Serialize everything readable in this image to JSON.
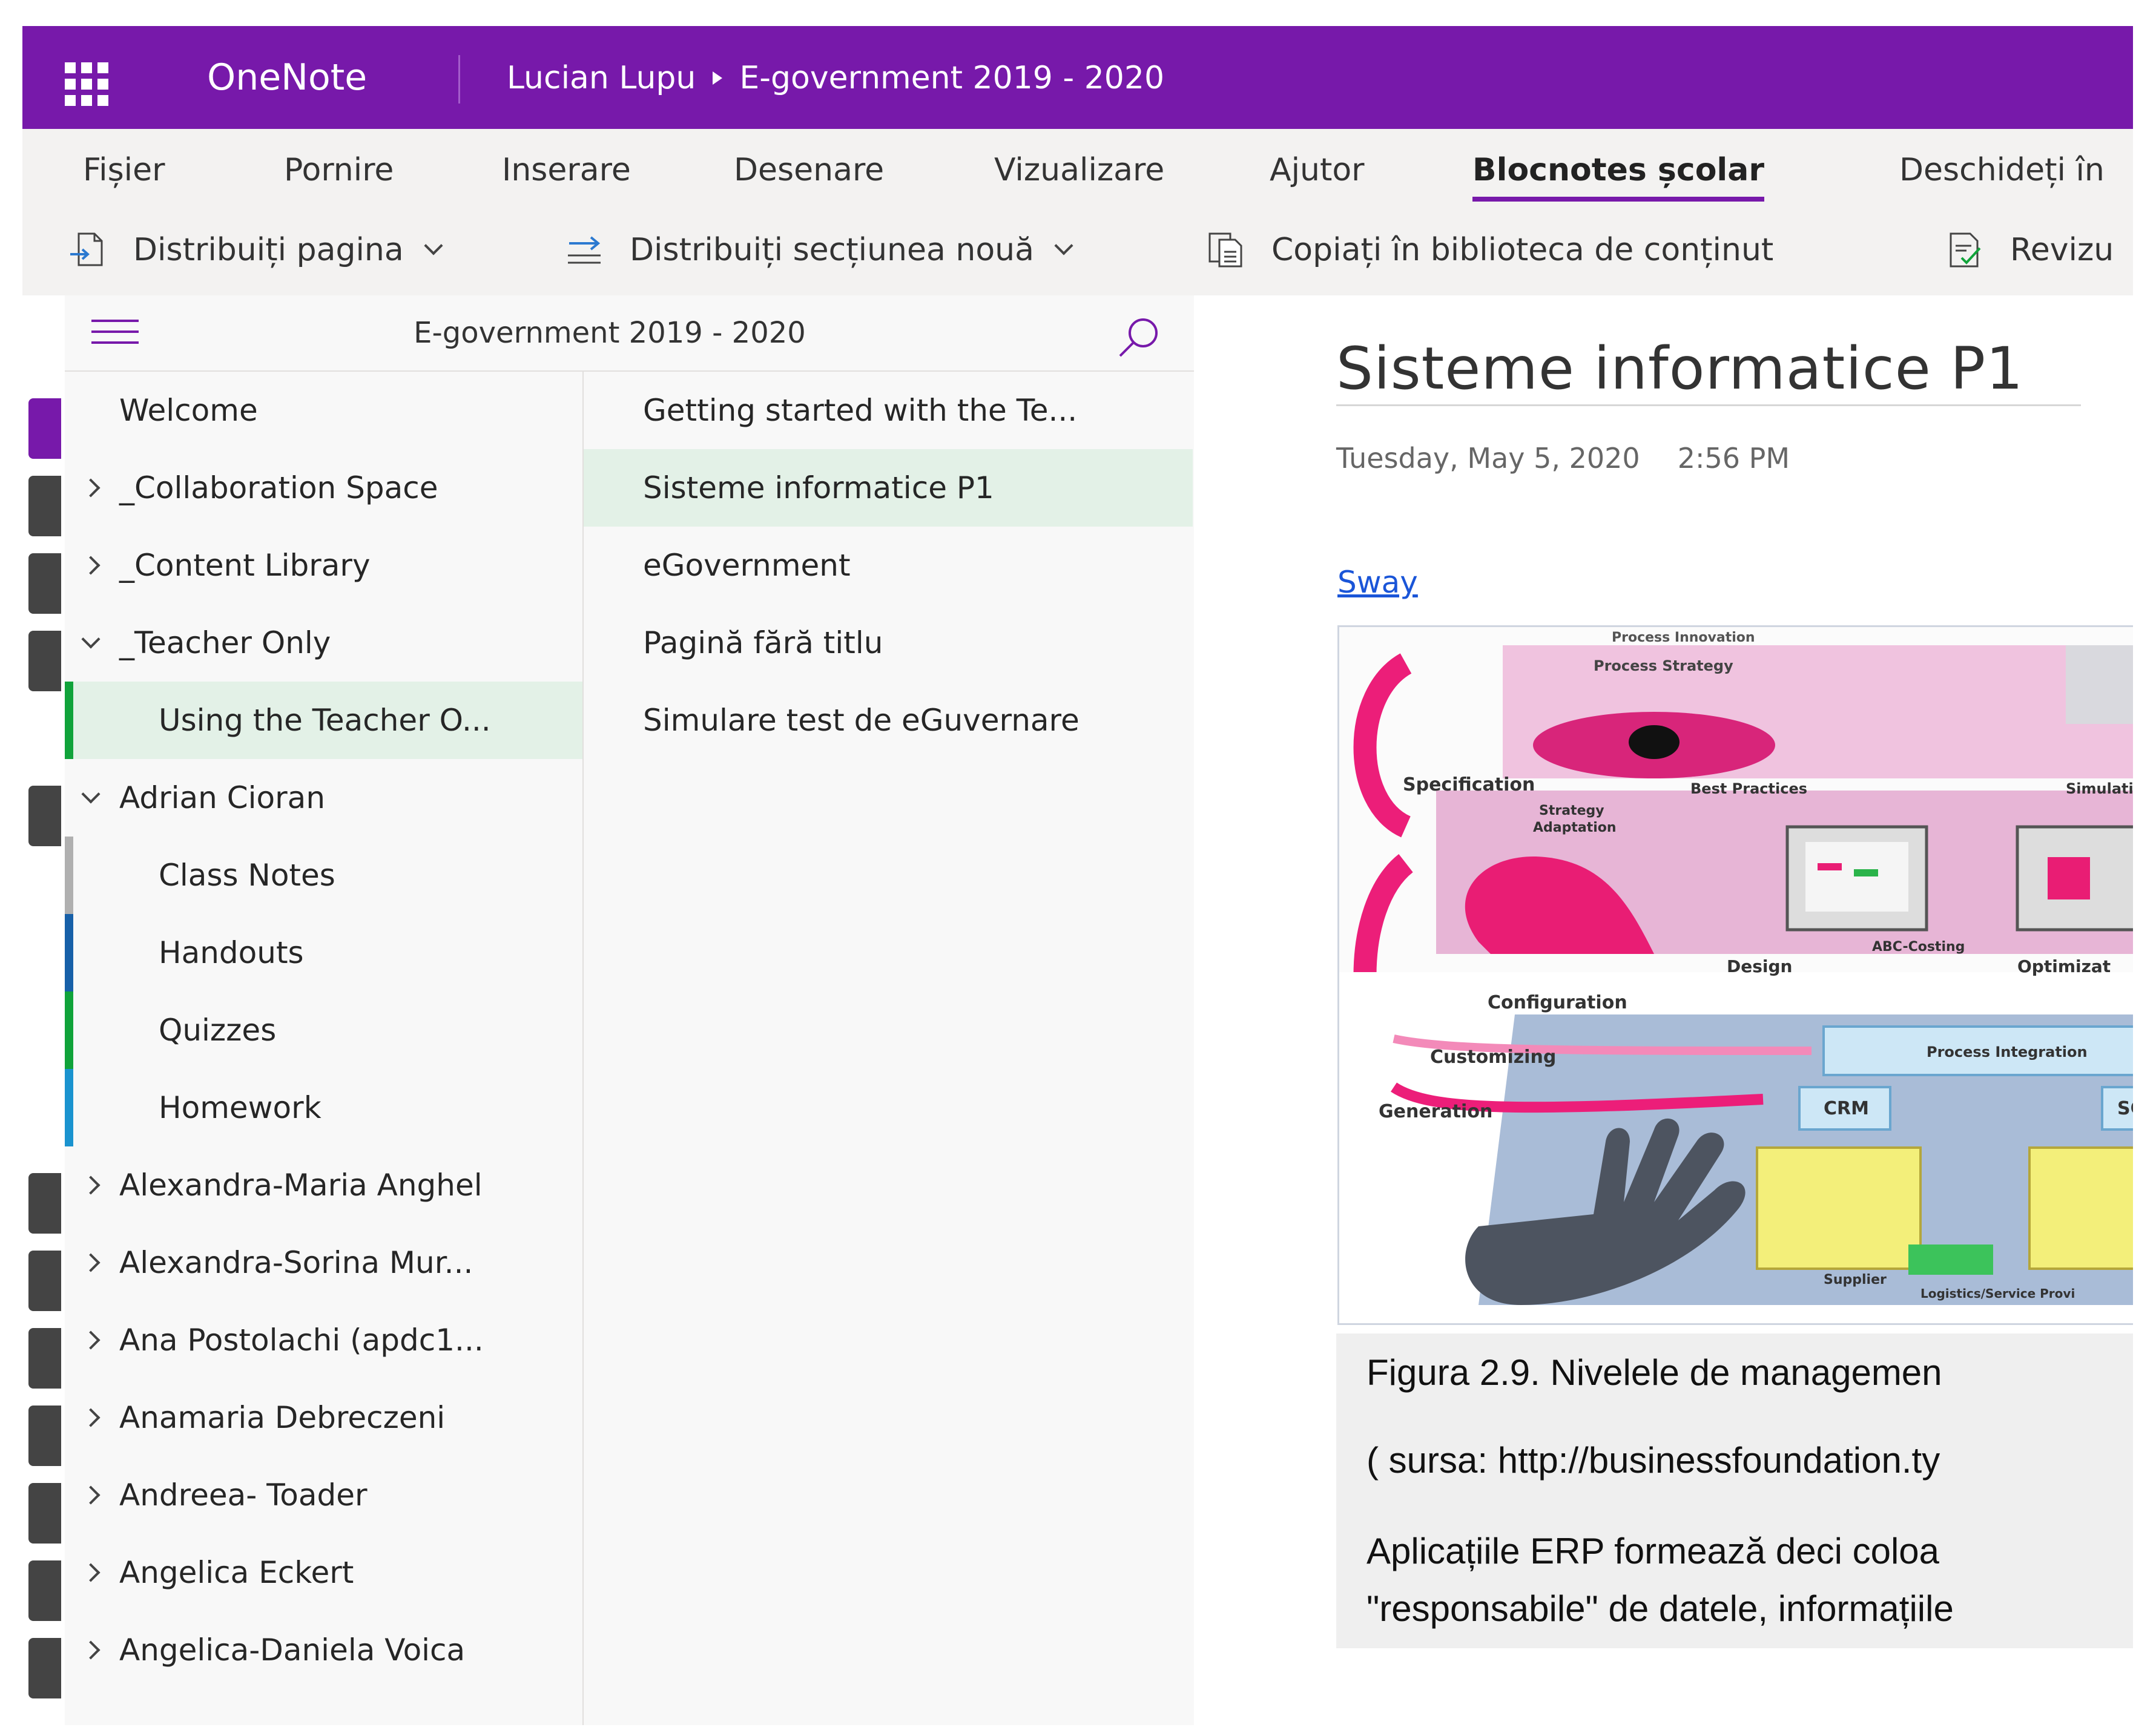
{
  "titlebar": {
    "app_name": "OneNote",
    "owner": "Lucian Lupu",
    "notebook": "E-government 2019 - 2020",
    "bg_color": "#7719aa"
  },
  "menu": {
    "tabs": [
      {
        "label": "Fișier"
      },
      {
        "label": "Pornire"
      },
      {
        "label": "Inserare"
      },
      {
        "label": "Desenare"
      },
      {
        "label": "Vizualizare"
      },
      {
        "label": "Ajutor"
      },
      {
        "label": "Blocnotes școlar",
        "active": true
      },
      {
        "label": "Deschideți în"
      }
    ]
  },
  "ribbon": {
    "distribute_page": "Distribuiți pagina",
    "distribute_section": "Distribuiți secțiunea nouă",
    "copy_library": "Copiați în biblioteca de conținut",
    "review": "Revizu"
  },
  "nav": {
    "notebook_title": "E-government 2019 - 2020",
    "sections": [
      {
        "label": "Welcome",
        "indent": 0,
        "expand": "none",
        "color": "#7719aa"
      },
      {
        "label": "_Collaboration Space",
        "indent": 0,
        "expand": "collapsed",
        "color": "#444444"
      },
      {
        "label": "_Content Library",
        "indent": 0,
        "expand": "collapsed",
        "color": "#444444"
      },
      {
        "label": "_Teacher Only",
        "indent": 0,
        "expand": "expanded",
        "color": "#444444"
      },
      {
        "label": "Using the Teacher O...",
        "indent": 1,
        "expand": "none",
        "color": "#10a33a",
        "selected": true
      },
      {
        "label": "Adrian Cioran",
        "indent": 0,
        "expand": "expanded",
        "color": "#444444"
      },
      {
        "label": "Class Notes",
        "indent": 1,
        "expand": "none",
        "color": "#b0b0b0"
      },
      {
        "label": "Handouts",
        "indent": 1,
        "expand": "none",
        "color": "#1760a8"
      },
      {
        "label": "Quizzes",
        "indent": 1,
        "expand": "none",
        "color": "#10a33a"
      },
      {
        "label": "Homework",
        "indent": 1,
        "expand": "none",
        "color": "#1a93cf"
      },
      {
        "label": "Alexandra-Maria Anghel",
        "indent": 0,
        "expand": "collapsed",
        "color": "#444444"
      },
      {
        "label": "Alexandra-Sorina Mur...",
        "indent": 0,
        "expand": "collapsed",
        "color": "#444444"
      },
      {
        "label": "Ana Postolachi (apdc1...",
        "indent": 0,
        "expand": "collapsed",
        "color": "#444444"
      },
      {
        "label": "Anamaria Debreczeni",
        "indent": 0,
        "expand": "collapsed",
        "color": "#444444"
      },
      {
        "label": "Andreea- Toader",
        "indent": 0,
        "expand": "collapsed",
        "color": "#444444"
      },
      {
        "label": "Angelica Eckert",
        "indent": 0,
        "expand": "collapsed",
        "color": "#444444"
      },
      {
        "label": "Angelica-Daniela Voica",
        "indent": 0,
        "expand": "collapsed",
        "color": "#444444"
      }
    ],
    "pages": [
      {
        "label": "Getting started with the Te..."
      },
      {
        "label": "Sisteme informatice P1",
        "selected": true
      },
      {
        "label": "eGovernment"
      },
      {
        "label": "Pagină fără titlu"
      },
      {
        "label": "Simulare test de eGuvernare"
      }
    ]
  },
  "page": {
    "title": "Sisteme informatice P1",
    "date": "Tuesday, May 5, 2020",
    "time": "2:56 PM",
    "link": "Sway",
    "figure": {
      "labels": {
        "process_innovation": "Process Innovation",
        "process_strategy": "Process Strategy",
        "specification": "Specification",
        "strategy_adaptation_1": "Strategy",
        "strategy_adaptation_2": "Adaptation",
        "best_practices": "Best Practices",
        "simulation": "Simulation",
        "abc_costing": "ABC-Costing",
        "design": "Design",
        "optimization": "Optimizat",
        "configuration": "Configuration",
        "process_integration": "Process Integration",
        "customizing": "Customizing",
        "generation": "Generation",
        "crm": "CRM",
        "sc": "SC",
        "supplier": "Supplier",
        "logistics": "Logistics/Service Provi"
      }
    },
    "caption": "Figura 2.9. Nivelele de managemen",
    "source": "( sursa: http://businessfoundation.ty",
    "para_line1": "Aplicațiile ERP formează deci coloa",
    "para_line2": "\"responsabile\" de datele, informațiile"
  }
}
